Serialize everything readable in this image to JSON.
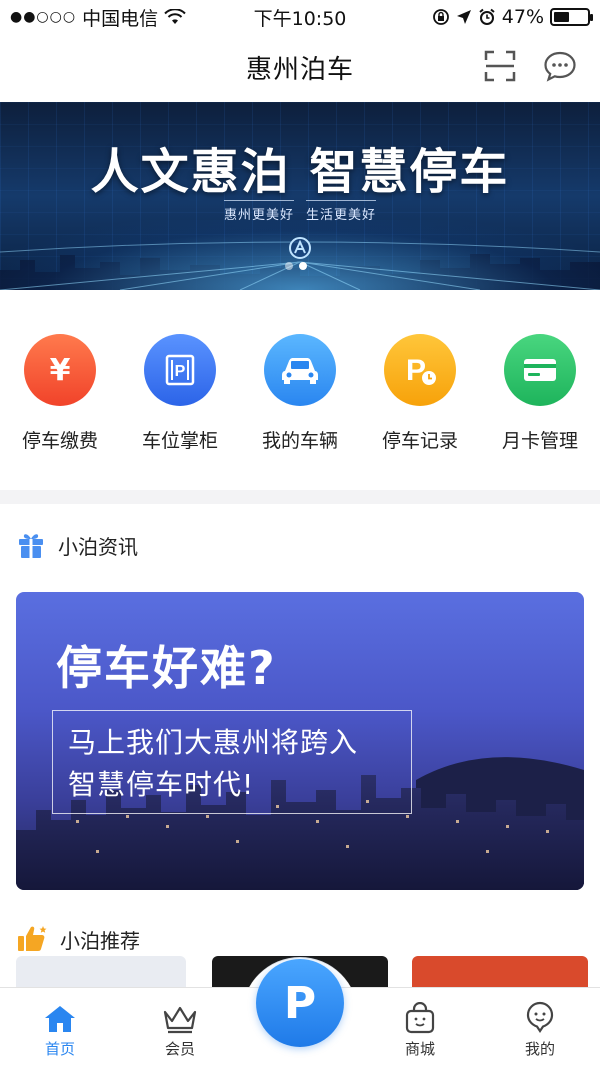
{
  "status_bar": {
    "carrier": "中国电信",
    "time": "下午10:50",
    "battery": "47%",
    "battery_level": 0.47
  },
  "nav": {
    "title": "惠州泊车",
    "scan_icon": "scan-icon",
    "message_icon": "message-icon"
  },
  "banner": {
    "title": "人文惠泊 智慧停车",
    "sub1": "惠州更美好",
    "sub2": "生活更美好",
    "slide_count": 2,
    "active_slide": 1
  },
  "quick_actions": [
    {
      "label": "停车缴费",
      "icon": "yen-icon",
      "glyph": "¥",
      "color": "#f1432a"
    },
    {
      "label": "车位掌柜",
      "icon": "parking-box-icon",
      "glyph": "P",
      "color": "#2c64e8"
    },
    {
      "label": "我的车辆",
      "icon": "car-icon",
      "glyph": "",
      "color": "#2a86f0"
    },
    {
      "label": "停车记录",
      "icon": "parking-clock-icon",
      "glyph": "P",
      "color": "#f7a20a"
    },
    {
      "label": "月卡管理",
      "icon": "card-icon",
      "glyph": "",
      "color": "#1eb45c"
    }
  ],
  "news_section": {
    "title": "小泊资讯",
    "icon": "gift-icon",
    "card": {
      "headline": "停车好难?",
      "line1": "马上我们大惠州将跨入",
      "line2": "智慧停车时代!"
    }
  },
  "recommend_section": {
    "title": "小泊推荐",
    "icon": "thumbs-up-icon"
  },
  "tab_bar": {
    "items": [
      {
        "label": "首页",
        "icon": "home-icon",
        "active": true
      },
      {
        "label": "会员",
        "icon": "crown-icon",
        "active": false
      },
      {
        "label": "商城",
        "icon": "shopping-bag-icon",
        "active": false
      },
      {
        "label": "我的",
        "icon": "profile-icon",
        "active": false
      }
    ],
    "center_label": "P",
    "center_icon": "parking-icon",
    "active_color": "#2a86f0"
  }
}
